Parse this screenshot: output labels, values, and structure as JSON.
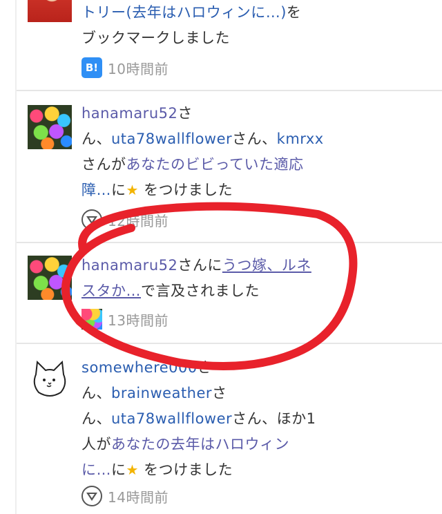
{
  "notifications": [
    {
      "avatar": "person-red-shirt",
      "line1": "トリー(去年はハロウィンに…)",
      "line1_suffix": "を",
      "line2": "ブックマークしました",
      "icon": "hatena-bookmark-icon",
      "icon_text": "B!",
      "time": "10時間前"
    },
    {
      "avatar": "rainbow-flowers",
      "user1": "hanamaru52",
      "san1": "さ",
      "san1b": "ん、",
      "user2": "uta78wallflower",
      "san2": "さん、",
      "user3": "kmrxx",
      "san3": "さんが",
      "link": "あなたのビビっていた適応",
      "link_cont": "障…",
      "ni": "に",
      "star": "★",
      "action": "をつけました",
      "icon": "star-badge-icon",
      "time": "12時間前"
    },
    {
      "avatar": "rainbow-flowers",
      "user1": "hanamaru52",
      "san1": "さんに",
      "link": "うつ嫁、ルネ",
      "link_cont": "スタか…",
      "action": "で言及されました",
      "icon": "flower-thumb-icon",
      "time": "13時間前"
    },
    {
      "avatar": "cat-doodle",
      "user1": "somewhere000",
      "san1": "さ",
      "san1b": "ん、",
      "user2": "brainweather",
      "san2": "さ",
      "san2b": "ん、",
      "user3": "uta78wallflower",
      "san3": "さん、ほか1",
      "san3b": "人が",
      "link": "あなたの去年はハロウィン",
      "link_cont": "に…",
      "ni": "に",
      "star": "★",
      "action": "をつけました",
      "icon": "star-badge-icon",
      "time": "14時間前"
    }
  ],
  "annotation_color": "#e8222b"
}
